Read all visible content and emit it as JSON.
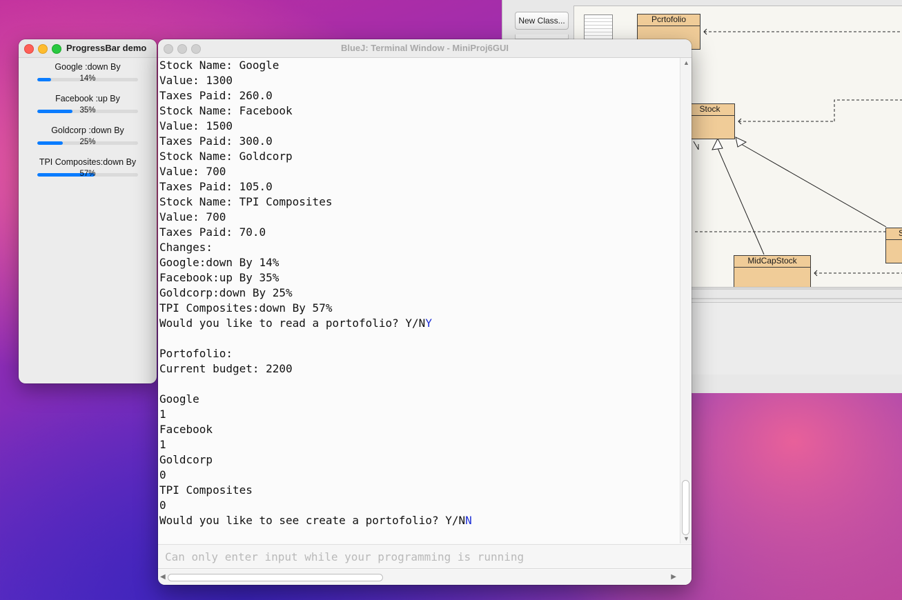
{
  "bluej_main": {
    "new_class_label": "New Class...",
    "classes": {
      "portfolio": "Pcrtofolio",
      "stock": "Stock",
      "midcap": "MidCapStock",
      "partial_s": "S"
    }
  },
  "progress_window": {
    "title": "ProgressBar demo",
    "items": [
      {
        "label": "Google :down By",
        "percent_text": "14%",
        "value": 14
      },
      {
        "label": "Facebook :up By",
        "percent_text": "35%",
        "value": 35
      },
      {
        "label": "Goldcorp :down By",
        "percent_text": "25%",
        "value": 25
      },
      {
        "label": "TPI Composites:down By",
        "percent_text": "57%",
        "value": 57
      }
    ],
    "accent": "#0a7cff"
  },
  "terminal": {
    "title": "BlueJ: Terminal Window - MiniProj6GUI",
    "lines": [
      {
        "text": "Stock Name: Google"
      },
      {
        "text": "Value: 1300"
      },
      {
        "text": "Taxes Paid: 260.0"
      },
      {
        "text": "Stock Name: Facebook"
      },
      {
        "text": "Value: 1500"
      },
      {
        "text": "Taxes Paid: 300.0"
      },
      {
        "text": "Stock Name: Goldcorp"
      },
      {
        "text": "Value: 700"
      },
      {
        "text": "Taxes Paid: 105.0"
      },
      {
        "text": "Stock Name: TPI Composites"
      },
      {
        "text": "Value: 700"
      },
      {
        "text": "Taxes Paid: 70.0"
      },
      {
        "text": "Changes:"
      },
      {
        "text": "Google:down By 14%"
      },
      {
        "text": "Facebook:up By 35%"
      },
      {
        "text": "Goldcorp:down By 25%"
      },
      {
        "text": "TPI Composites:down By 57%"
      },
      {
        "text": "Would you like to read a portofolio? Y/N",
        "input": "Y"
      },
      {
        "text": ""
      },
      {
        "text": "Portofolio:"
      },
      {
        "text": "Current budget: 2200"
      },
      {
        "text": ""
      },
      {
        "text": "Google"
      },
      {
        "text": "1"
      },
      {
        "text": "Facebook"
      },
      {
        "text": "1"
      },
      {
        "text": "Goldcorp"
      },
      {
        "text": "0"
      },
      {
        "text": "TPI Composites"
      },
      {
        "text": "0"
      },
      {
        "text": "Would you like to see create a portofolio? Y/N",
        "input": "N"
      }
    ],
    "input_placeholder": "Can only enter input while your programming is running",
    "user_input_color": "#1d2fd6"
  }
}
